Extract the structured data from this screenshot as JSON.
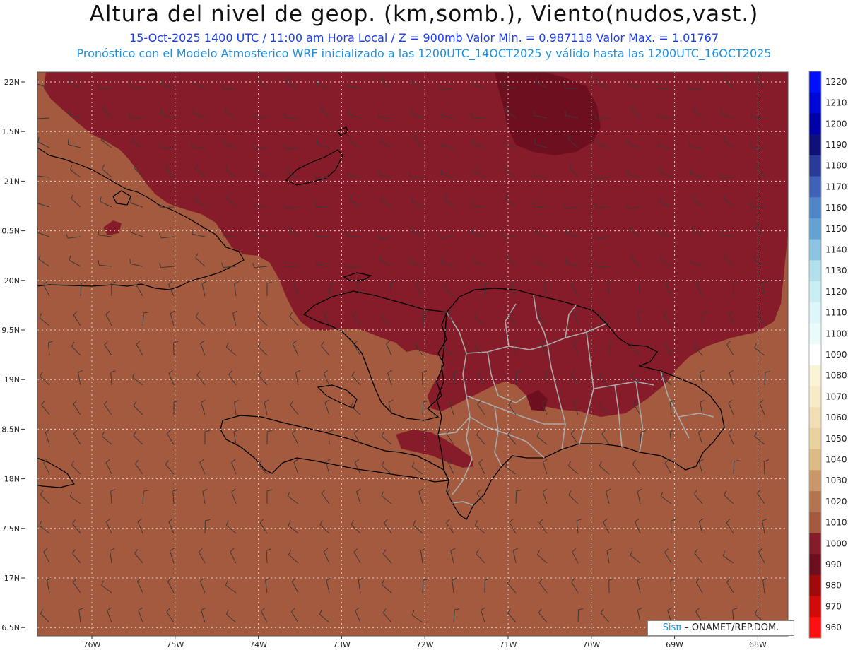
{
  "header": {
    "title": "Altura del nivel de geop. (km,somb.), Viento(nudos,vast.)",
    "subtitle": "15-Oct-2025  1400 UTC / 11:00 am Hora Local / Z = 900mb   Valor Min. = 0.987118  Valor Max. = 1.01767",
    "description": "Pronóstico con el Modelo Atmosferico WRF inicializado a las 1200UTC_14OCT2025 y válido hasta las  1200UTC_16OCT2025"
  },
  "map": {
    "lat_labels": [
      "22N",
      "1.5N",
      "21N",
      "0.5N",
      "20N",
      "9.5N",
      "19N",
      "8.5N",
      "18N",
      "7.5N",
      "17N",
      "6.5N"
    ],
    "lon_labels": [
      "76W",
      "75W",
      "74W",
      "73W",
      "72W",
      "71W",
      "70W",
      "69W",
      "68W"
    ],
    "fill_colors": {
      "base": "#A45A3E",
      "low": "#861B2A",
      "lower": "#6E0F20"
    }
  },
  "colorbar": {
    "levels": [
      1220,
      1210,
      1200,
      1190,
      1180,
      1170,
      1160,
      1150,
      1140,
      1130,
      1120,
      1110,
      1100,
      1090,
      1080,
      1070,
      1060,
      1050,
      1040,
      1030,
      1020,
      1010,
      1000,
      990,
      980,
      970,
      960
    ],
    "colors": [
      "#0011FF",
      "#0008D8",
      "#0000A8",
      "#10107A",
      "#2A3A9A",
      "#3F62B8",
      "#4E86C8",
      "#64A2D4",
      "#8DC4E2",
      "#B4E0EE",
      "#C9EEF4",
      "#DCF6F9",
      "#EAFBFC",
      "#FFFFFF",
      "#FBF3D6",
      "#F7EAC8",
      "#F2DFB5",
      "#EAD2A0",
      "#DDBB86",
      "#C9976A",
      "#B27550",
      "#A45A3E",
      "#861B2A",
      "#6E0F20",
      "#A00A0A",
      "#D20A0A",
      "#FF1010"
    ]
  },
  "credit": {
    "sis": "Sis",
    "pi": "π",
    "org": "– ONAMET/REP.DOM."
  }
}
